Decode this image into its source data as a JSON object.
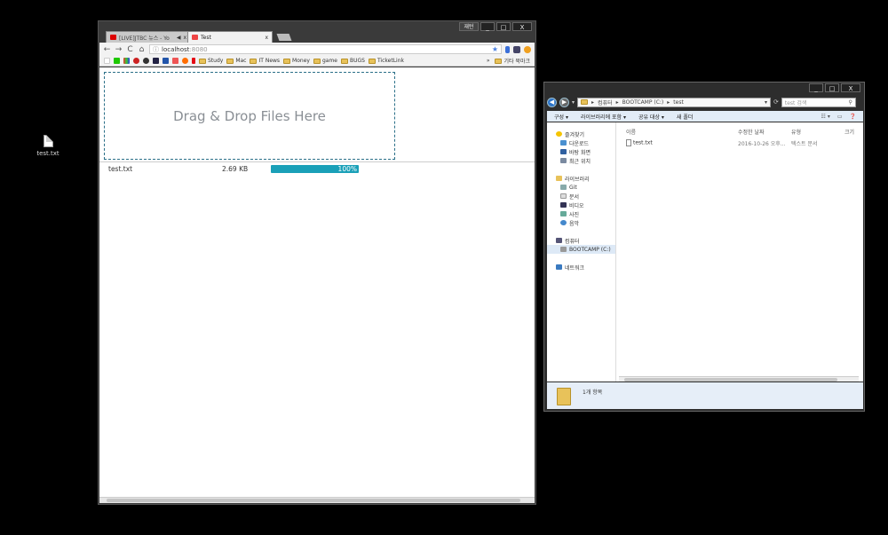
{
  "desktop": {
    "icon_label": "test.txt"
  },
  "chrome": {
    "window_buttons": {
      "ime": "재턴",
      "minimize": "_",
      "maximize": "□",
      "close": "X"
    },
    "tabs": [
      {
        "label": "[LIVE]JTBC 뉴스 - Yo",
        "active": false
      },
      {
        "label": "Test",
        "active": true
      }
    ],
    "tab_close": "x",
    "nav": {
      "back": "←",
      "forward": "→",
      "reload": "C",
      "home": "⌂"
    },
    "address": {
      "host": "localhost",
      "port": ":8080"
    },
    "bookmarks": {
      "folders": [
        "Study",
        "Mac",
        "IT News",
        "Money",
        "game",
        "BUGS",
        "TicketLink"
      ],
      "overflow": "»",
      "other": "기타 북마크"
    },
    "dropzone_text": "Drag & Drop Files Here",
    "upload": {
      "file_name": "test.txt",
      "file_size": "2.69 KB",
      "progress_label": "100%",
      "progress": 1.0
    }
  },
  "explorer": {
    "window_buttons": {
      "minimize": "_",
      "maximize": "□",
      "close": "X"
    },
    "path": [
      "컴퓨터",
      "BOOTCAMP (C:)",
      "test"
    ],
    "search_placeholder": "test 검색",
    "commands": [
      "구성 ▾",
      "라이브러리에 포함 ▾",
      "공유 대상 ▾",
      "새 폴더"
    ],
    "nav": {
      "favorites": "즐겨찾기",
      "favorites_items": [
        "다운로드",
        "바탕 화면",
        "최근 위치"
      ],
      "libraries": "라이브러리",
      "library_items": [
        "Git",
        "문서",
        "비디오",
        "사진",
        "음악"
      ],
      "computer": "컴퓨터",
      "computer_items": [
        "BOOTCAMP (C:)"
      ],
      "network": "네트워크"
    },
    "columns": [
      "이름",
      "수정한 날짜",
      "유형",
      "크기"
    ],
    "files": [
      {
        "name": "test.txt",
        "modified": "2016-10-26 오후...",
        "type": "텍스트 문서"
      }
    ],
    "status": "1개 항목"
  }
}
